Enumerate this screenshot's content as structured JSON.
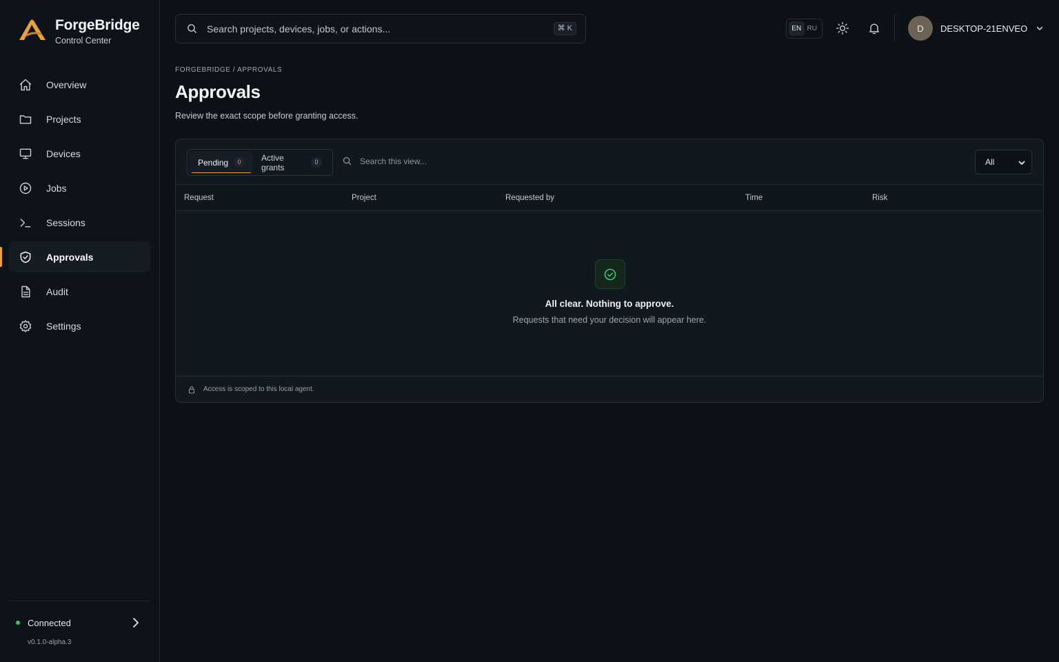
{
  "brand": {
    "name": "ForgeBridge",
    "subtitle": "Control Center",
    "accent": "#e9a23b"
  },
  "sidebar": {
    "items": [
      {
        "label": "Overview",
        "icon": "home-icon"
      },
      {
        "label": "Projects",
        "icon": "folder-icon"
      },
      {
        "label": "Devices",
        "icon": "monitor-icon"
      },
      {
        "label": "Jobs",
        "icon": "play-circle-icon"
      },
      {
        "label": "Sessions",
        "icon": "terminal-icon"
      },
      {
        "label": "Approvals",
        "icon": "shield-check-icon",
        "active": true
      },
      {
        "label": "Audit",
        "icon": "document-icon"
      },
      {
        "label": "Settings",
        "icon": "gear-icon"
      }
    ],
    "status": {
      "label": "Connected",
      "color": "#37c46b"
    },
    "version": "v0.1.0-alpha.3"
  },
  "topbar": {
    "search_placeholder": "Search projects, devices, jobs, or actions...",
    "shortcut": "⌘ K",
    "languages": [
      "EN",
      "RU"
    ],
    "active_language": "EN",
    "user": {
      "initial": "D",
      "name": "DESKTOP-21ENVEO"
    }
  },
  "page": {
    "breadcrumb": "FORGEBRIDGE / APPROVALS",
    "title": "Approvals",
    "subtitle": "Review the exact scope before granting access."
  },
  "panel": {
    "tabs": [
      {
        "label": "Pending",
        "count": "0",
        "active": true
      },
      {
        "label": "Active grants",
        "count": "0"
      }
    ],
    "search_placeholder": "Search this view...",
    "filter_value": "All",
    "columns": [
      "Request",
      "Project",
      "Requested by",
      "Time",
      "Risk"
    ],
    "empty": {
      "title": "All clear. Nothing to approve.",
      "subtitle": "Requests that need your decision will appear here.",
      "icon": "check-circle-icon"
    },
    "footer": "Access is scoped to this local agent."
  }
}
